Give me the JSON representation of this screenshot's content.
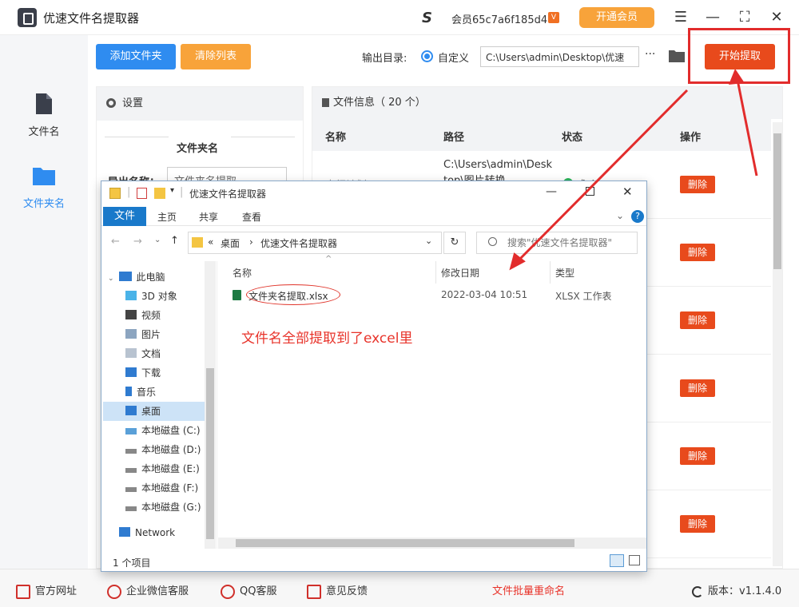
{
  "app": {
    "title": "优速文件名提取器",
    "member_id": "会员65c7a6f185d4",
    "vip_badge": "V",
    "vip_button": "开通会员",
    "window_controls": [
      "☰",
      "—",
      "⛶",
      "✕"
    ]
  },
  "sidebar": {
    "items": [
      {
        "label": "文件名",
        "icon": "file-icon"
      },
      {
        "label": "文件夹名",
        "icon": "folder-icon",
        "active": true
      }
    ]
  },
  "toolbar": {
    "add_folder": "添加文件夹",
    "clear_list": "清除列表",
    "output_label": "输出目录:",
    "radio_label": "自定义",
    "output_path": "C:\\Users\\admin\\Desktop\\优速",
    "more": "···",
    "start": "开始提取"
  },
  "settings": {
    "header": "设置",
    "section": "文件夹名",
    "export_label": "导出名称：",
    "export_value": "文件夹名提取"
  },
  "fileinfo": {
    "header": "文件信息（ 20 个）",
    "columns": [
      "名称",
      "路径",
      "状态",
      "操作"
    ],
    "row1_name": "出行计划",
    "row1_path": "C:\\Users\\admin\\Desktop\\图片转换",
    "row1_status": "成功",
    "delete_label": "删除"
  },
  "explorer": {
    "title": "优速文件名提取器",
    "tabs": [
      "文件",
      "主页",
      "共享",
      "查看"
    ],
    "breadcrumb": [
      "«",
      "桌面",
      "›",
      "优速文件名提取器"
    ],
    "search_placeholder": "搜索\"优速文件名提取器\"",
    "nav": [
      "此电脑",
      "3D 对象",
      "视频",
      "图片",
      "文档",
      "下载",
      "音乐",
      "桌面",
      "本地磁盘 (C:)",
      "本地磁盘 (D:)",
      "本地磁盘 (E:)",
      "本地磁盘 (F:)",
      "本地磁盘 (G:)",
      "Network"
    ],
    "list_columns": [
      "名称",
      "修改日期",
      "类型"
    ],
    "file_name": "文件夹名提取.xlsx",
    "file_date": "2022-03-04 10:51",
    "file_type": "XLSX 工作表",
    "status": "1 个项目"
  },
  "annotation": {
    "note": "文件名全部提取到了excel里"
  },
  "footer": {
    "site": "官方网址",
    "wechat": "企业微信客服",
    "qq": "QQ客服",
    "feedback": "意见反馈",
    "rename": "文件批量重命名",
    "version": "版本：v1.1.4.0"
  },
  "colors": {
    "accent_blue": "#2f8cf0",
    "accent_orange": "#f8a33a",
    "start_red": "#e84a1c",
    "annotation_red": "#e22c2c",
    "explorer_blue": "#1979ca"
  }
}
